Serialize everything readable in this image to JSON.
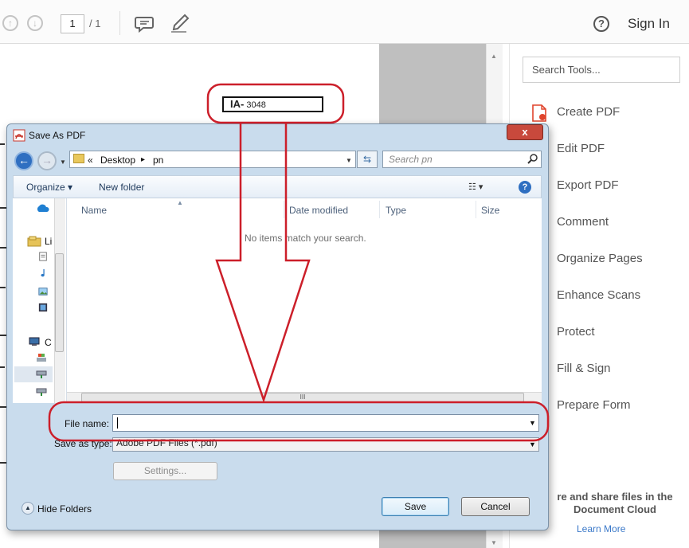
{
  "toolbar": {
    "page_current": "1",
    "page_total": "/ 1",
    "sign_in": "Sign In",
    "help": "?",
    "up_icon": "page-up-icon",
    "down_icon": "page-down-icon",
    "comment_icon": "comment-icon",
    "highlight_icon": "highlight-pen-icon"
  },
  "document": {
    "ia_prefix": "IA-",
    "ia_number": "3048"
  },
  "tools_pane": {
    "search_placeholder": "Search Tools...",
    "items": [
      {
        "label": "Create PDF"
      },
      {
        "label": "Edit PDF"
      },
      {
        "label": "Export PDF"
      },
      {
        "label": "Comment"
      },
      {
        "label": "Organize Pages"
      },
      {
        "label": "Enhance Scans"
      },
      {
        "label": "Protect"
      },
      {
        "label": "Fill & Sign"
      },
      {
        "label": "Prepare Form"
      }
    ],
    "cloud_line1": "re and share files in the",
    "cloud_line2": "Document Cloud",
    "learn_more": "Learn More"
  },
  "dialog": {
    "title": "Save As PDF",
    "close": "x",
    "address": {
      "chevrons": "«",
      "crumbs": [
        "Desktop",
        "pn"
      ],
      "separator": "▸"
    },
    "search_placeholder": "Search pn",
    "organize": "Organize ▾",
    "new_folder": "New folder",
    "help": "?",
    "nav_labels": {
      "libraries": "Li",
      "computer": "C"
    },
    "columns": [
      "Name",
      "Date modified",
      "Type",
      "Size"
    ],
    "empty_message": "No items match your search.",
    "file_name_label": "File name:",
    "file_name_value": "",
    "save_type_label": "Save as type:",
    "save_type_value": "Adobe PDF Files (*.pdf)",
    "settings_button": "Settings...",
    "hide_folders": "Hide Folders",
    "save_button": "Save",
    "cancel_button": "Cancel",
    "scroll_grip": "III"
  },
  "colors": {
    "annotation_red": "#cc1f2a",
    "dialog_frame": "#c9dced",
    "link_blue": "#3b79c9",
    "acrobat_red": "#e0442c"
  }
}
